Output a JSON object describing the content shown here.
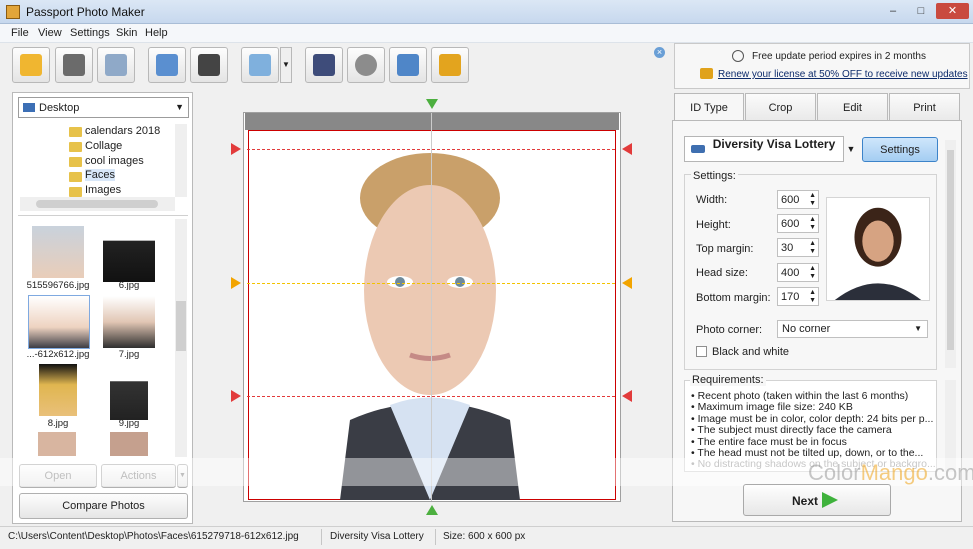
{
  "window": {
    "title": "Passport Photo Maker",
    "min": "–",
    "max": "□",
    "close": "✕"
  },
  "menu": [
    "File",
    "View",
    "Settings",
    "Skin",
    "Help"
  ],
  "toolbar": {
    "icons": [
      "open-wizard-icon",
      "save-icon",
      "print-icon",
      "user-photo-icon",
      "camera-icon",
      "monitor-icon",
      "help-book-icon",
      "film-reel-icon",
      "home-house-icon",
      "shopping-cart-icon"
    ],
    "close_glyph": "×",
    "dropdown_glyph": "▼"
  },
  "update": {
    "message": "Free update period expires in 2 months",
    "link": "Renew your license at 50% OFF to receive new updates"
  },
  "browser": {
    "folder": "Desktop",
    "tree": [
      "calendars 2018",
      "Collage",
      "cool images",
      "Faces",
      "Images"
    ],
    "thumbnails": [
      "515596766.jpg",
      "6.jpg",
      "...-612x612.jpg",
      "7.jpg",
      "8.jpg",
      "9.jpg"
    ],
    "open_label": "Open",
    "actions_label": "Actions",
    "compare_label": "Compare Photos"
  },
  "tabs": [
    "ID Type",
    "Crop",
    "Edit",
    "Print"
  ],
  "id_type": {
    "document": "Diversity Visa Lottery",
    "settings_button": "Settings",
    "settings_title": "Settings:",
    "fields": [
      {
        "label": "Width:",
        "value": "600"
      },
      {
        "label": "Height:",
        "value": "600"
      },
      {
        "label": "Top margin:",
        "value": "30"
      },
      {
        "label": "Head size:",
        "value": "400"
      },
      {
        "label": "Bottom margin:",
        "value": "170"
      }
    ],
    "photo_corner_label": "Photo corner:",
    "photo_corner_value": "No corner",
    "bw_label": "Black and white",
    "requirements_title": "Requirements:",
    "requirements": [
      "Recent photo (taken within the last 6 months)",
      "Maximum image file size: 240 KB",
      "Image must be in color, color depth: 24 bits per p...",
      "The subject must directly face the camera",
      "The entire face must be in focus",
      "The head must not be tilted up, down, or to the...",
      "No distracting shadows on the subject or backgro..."
    ],
    "next_label": "Next"
  },
  "watermark": {
    "a": "Color",
    "b": "Mango",
    "c": ".com"
  },
  "status": {
    "path": "C:\\Users\\Content\\Desktop\\Photos\\Faces\\615279718-612x612.jpg",
    "doc": "Diversity Visa Lottery",
    "size": "Size: 600 x 600 px"
  },
  "colors": {
    "accent": "#3c83c9",
    "guide_red": "#e23b3b",
    "guide_yellow": "#f2c300",
    "guide_green": "#4caf3f"
  }
}
